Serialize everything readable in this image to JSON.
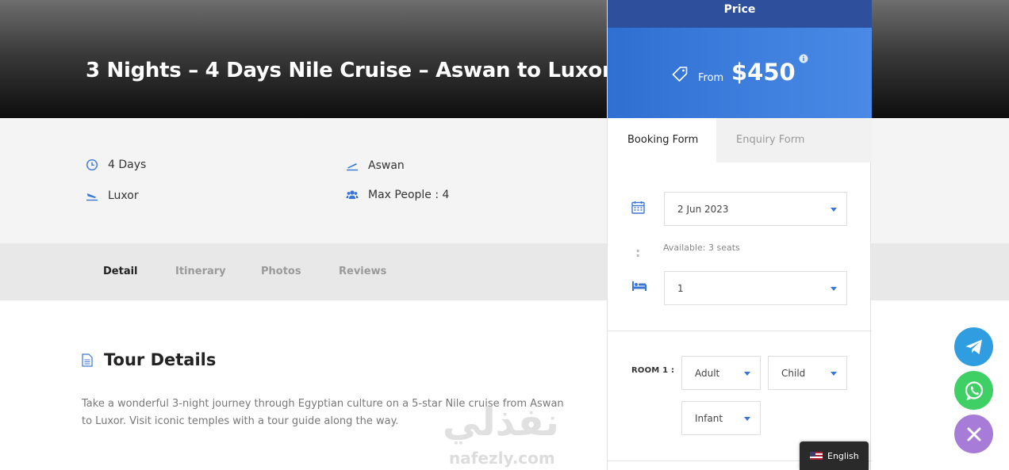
{
  "hero": {
    "title": "3 Nights – 4 Days Nile Cruise – Aswan to Luxor"
  },
  "meta": {
    "duration": "4 Days",
    "departure": "Aswan",
    "arrival": "Luxor",
    "max_people": "Max People : 4"
  },
  "tabs": [
    "Detail",
    "Itinerary",
    "Photos",
    "Reviews"
  ],
  "active_tab": "Detail",
  "details": {
    "heading": "Tour Details",
    "text": "Take a wonderful 3-night journey through Egyptian culture on a 5-star Nile cruise from Aswan to Luxor. Visit iconic temples with a tour guide along the way."
  },
  "watermark": {
    "arabic": "نفذلي",
    "latin": "nafezly.com"
  },
  "price": {
    "header": "Price",
    "from_label": "From",
    "amount": "$450"
  },
  "form_tabs": {
    "booking": "Booking Form",
    "enquiry": "Enquiry Form"
  },
  "booking": {
    "date_value": "2 Jun 2023",
    "availability": "Available: 3 seats",
    "colon": ":",
    "rooms_value": "1",
    "room_label": "ROOM 1 :",
    "adult_select": "Adult",
    "child_select": "Child",
    "infant_select": "Infant"
  },
  "language": {
    "label": "English"
  },
  "colors": {
    "price_header": "#2e4f9c",
    "price_box": "#3d7ee0",
    "accent_icon": "#3a76d6",
    "telegram": "#2f9de0",
    "whatsapp": "#3ed064",
    "close": "#a77bd8"
  }
}
